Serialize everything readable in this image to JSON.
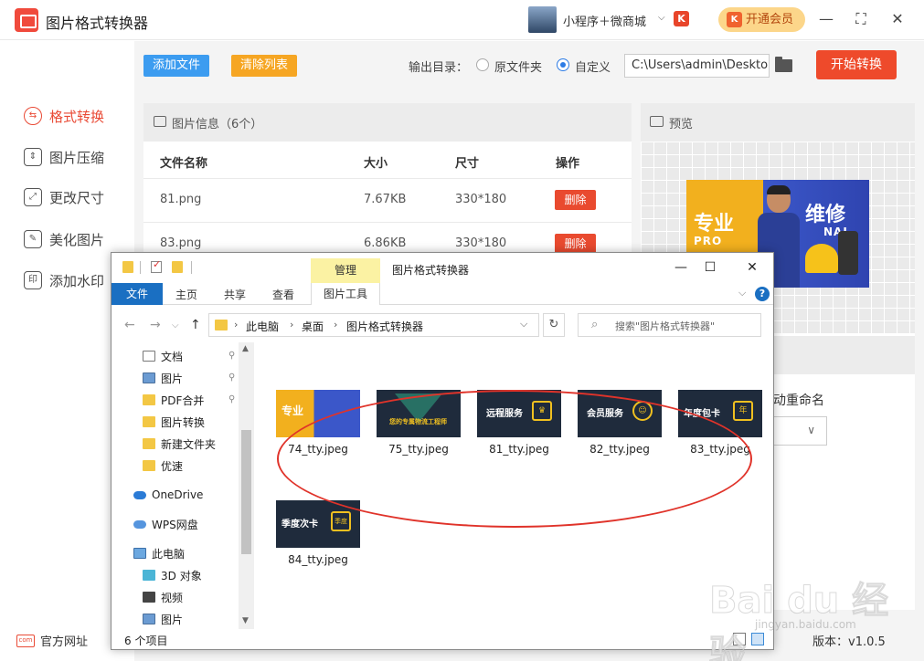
{
  "app": {
    "title": "图片格式转换器",
    "mini_program": "小程序＋微商城",
    "brand_badge": "K",
    "vip_label": "开通会员",
    "vip_icon": "K",
    "controls": {
      "minimize": "—",
      "maximize": "⛶",
      "close": "✕"
    }
  },
  "sidebar": {
    "items": [
      {
        "label": "格式转换",
        "icon": "convert-icon",
        "glyph": "⇆"
      },
      {
        "label": "图片压缩",
        "icon": "compress-icon",
        "glyph": "⇕"
      },
      {
        "label": "更改尺寸",
        "icon": "resize-icon",
        "glyph": "⤢"
      },
      {
        "label": "美化图片",
        "icon": "beautify-icon",
        "glyph": "✎"
      },
      {
        "label": "添加水印",
        "icon": "watermark-icon",
        "glyph": "印"
      }
    ],
    "official_site": "官方网址",
    "official_icon": "com"
  },
  "toolbar": {
    "add_file": "添加文件",
    "clear_list": "清除列表",
    "output_label": "输出目录：",
    "option_original": "原文件夹",
    "option_custom": "自定义",
    "path": "C:\\Users\\admin\\Deskto",
    "start": "开始转换"
  },
  "file_list": {
    "title": "图片信息（6个）",
    "columns": {
      "name": "文件名称",
      "size": "大小",
      "dims": "尺寸",
      "action": "操作"
    },
    "rows": [
      {
        "name": "81.png",
        "size": "7.67KB",
        "dims": "330*180",
        "action": "删除"
      },
      {
        "name": "83.png",
        "size": "6.86KB",
        "dims": "330*180",
        "action": "删除"
      }
    ]
  },
  "preview": {
    "title": "预览",
    "banner_left": "专业",
    "banner_right": "维修",
    "banner_sub": "PRO",
    "banner_sub2": "NAL"
  },
  "settings": {
    "rename_label": "动重命名",
    "dropdown_glyph": "∨"
  },
  "version": "版本：v1.0.5",
  "explorer": {
    "title": "图片格式转换器",
    "manage_tab": "管理",
    "picture_tools": "图片工具",
    "ribbon_tabs": [
      "文件",
      "主页",
      "共享",
      "查看"
    ],
    "help": "?",
    "controls": {
      "minimize": "—",
      "maximize": "☐",
      "close": "✕"
    },
    "breadcrumb": [
      "此电脑",
      "桌面",
      "图片格式转换器"
    ],
    "search_placeholder": "搜索\"图片格式转换器\"",
    "nav": {
      "quick": [
        "文档",
        "图片",
        "PDF合并",
        "图片转换",
        "新建文件夹",
        "优速"
      ],
      "cloud": [
        "OneDrive",
        "WPS网盘"
      ],
      "pc": [
        "此电脑",
        "3D 对象",
        "视频",
        "图片"
      ]
    },
    "files": [
      {
        "name": "74_tty.jpeg",
        "text": "专业"
      },
      {
        "name": "75_tty.jpeg",
        "text": "您的专属物流工程师"
      },
      {
        "name": "81_tty.jpeg",
        "text": "远程服务",
        "badge": "♛"
      },
      {
        "name": "82_tty.jpeg",
        "text": "会员服务",
        "badge": "☺"
      },
      {
        "name": "83_tty.jpeg",
        "text": "年度包卡",
        "badge": "年"
      },
      {
        "name": "84_tty.jpeg",
        "text": "季度次卡",
        "badge": "季度"
      }
    ],
    "status": "6 个项目"
  },
  "watermark": {
    "main": "Bai du 经验",
    "sub": "jingyan.baidu.com"
  }
}
